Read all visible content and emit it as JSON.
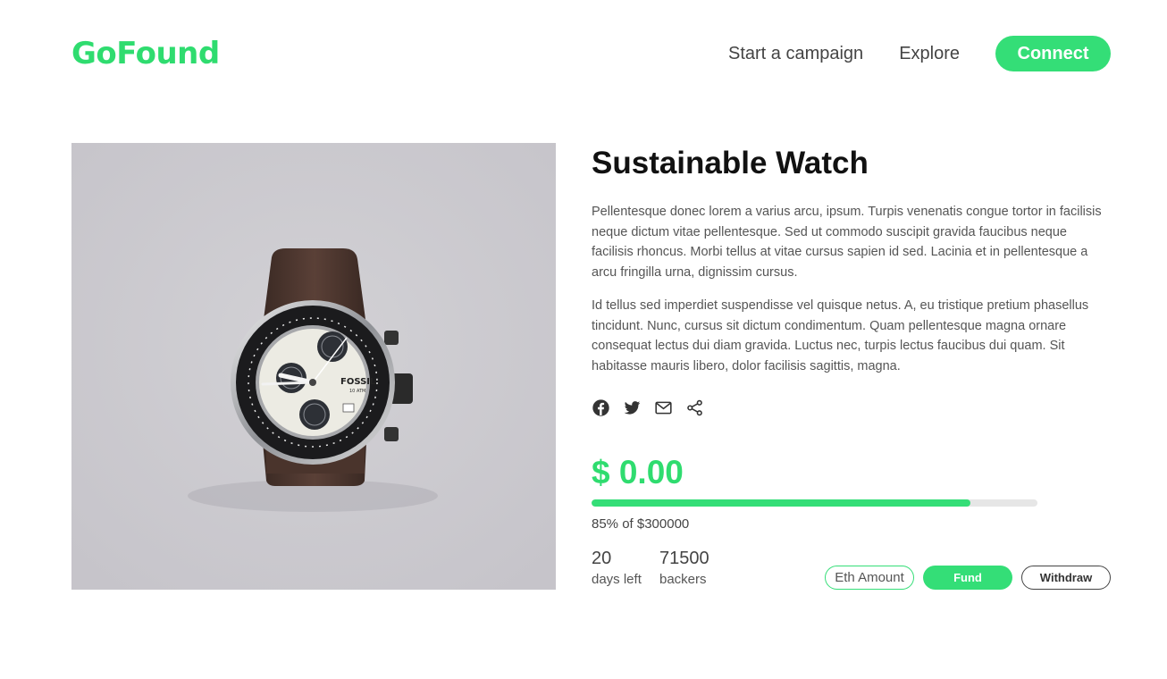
{
  "brand": {
    "name": "GoFound",
    "color": "#2fdc6f"
  },
  "nav": {
    "items": [
      {
        "label": "Start a campaign"
      },
      {
        "label": "Explore"
      }
    ],
    "connect_label": "Connect"
  },
  "campaign": {
    "image": {
      "subject": "wristwatch photo",
      "watch_brand": "FOSSIL",
      "watch_subtext": "10 ATM"
    },
    "title": "Sustainable Watch",
    "paragraphs": [
      "Pellentesque donec lorem a varius arcu, ipsum. Turpis venenatis congue tortor in facilisis neque dictum vitae pellentesque. Sed ut commodo suscipit gravida faucibus neque facilisis rhoncus. Morbi tellus at vitae cursus sapien id sed. Lacinia et in pellentesque a arcu fringilla urna, dignissim cursus.",
      "Id tellus sed imperdiet suspendisse vel quisque netus. A, eu tristique pretium phasellus tincidunt. Nunc, cursus sit dictum condimentum. Quam pellentesque magna ornare consequat lectus dui diam gravida. Luctus nec, turpis lectus faucibus dui quam. Sit habitasse mauris libero, dolor facilisis sagittis, magna."
    ],
    "share_icons": [
      "facebook-icon",
      "twitter-icon",
      "mail-icon",
      "share-icon"
    ],
    "raised": "$ 0.00",
    "progress_fraction": 0.85,
    "goal_text": "85% of $300000",
    "stats": [
      {
        "value": "20",
        "label": "days left"
      },
      {
        "value": "71500",
        "label": "backers"
      }
    ],
    "eth_placeholder": "Eth Amount",
    "fund_label": "Fund",
    "withdraw_label": "Withdraw"
  },
  "colors": {
    "accent": "#34de77",
    "progress_track": "#e6e6e6",
    "photo_background": "#cdcbd0"
  }
}
